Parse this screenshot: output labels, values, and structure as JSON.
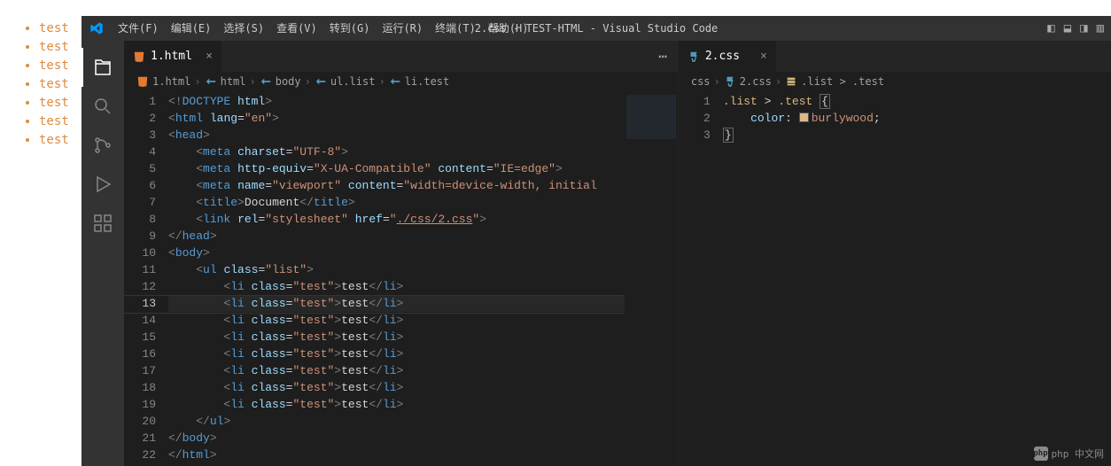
{
  "browser_list": [
    "test",
    "test",
    "test",
    "test",
    "test",
    "test",
    "test"
  ],
  "menu": [
    "文件(F)",
    "编辑(E)",
    "选择(S)",
    "查看(V)",
    "转到(G)",
    "运行(R)",
    "终端(T)",
    "帮助(H)"
  ],
  "window_title": "2.css - TEST-HTML - Visual Studio Code",
  "tabs_left": [
    {
      "label": "1.html",
      "icon": "html-icon",
      "active": true
    }
  ],
  "tabs_right": [
    {
      "label": "2.css",
      "icon": "css-icon",
      "active": true
    }
  ],
  "breadcrumb_left": [
    "1.html",
    "html",
    "body",
    "ul.list",
    "li.test"
  ],
  "breadcrumb_right": [
    "css",
    "2.css",
    ".list > .test"
  ],
  "code_left": {
    "current_line": 13,
    "lines": [
      {
        "n": 1,
        "html": "<span class='mtk-gray'>&lt;!</span><span class='mtk-blue'>DOCTYPE</span> <span class='mtk-lightblue'>html</span><span class='mtk-gray'>&gt;</span>"
      },
      {
        "n": 2,
        "html": "<span class='mtk-gray'>&lt;</span><span class='mtk-blue'>html</span> <span class='mtk-lightblue'>lang</span><span class='mtk-white'>=</span><span class='mtk-string'>\"en\"</span><span class='mtk-gray'>&gt;</span>"
      },
      {
        "n": 3,
        "html": "<span class='mtk-gray'>&lt;</span><span class='mtk-blue'>head</span><span class='mtk-gray'>&gt;</span>"
      },
      {
        "n": 4,
        "html": "    <span class='mtk-gray'>&lt;</span><span class='mtk-blue'>meta</span> <span class='mtk-lightblue'>charset</span><span class='mtk-white'>=</span><span class='mtk-string'>\"UTF-8\"</span><span class='mtk-gray'>&gt;</span>"
      },
      {
        "n": 5,
        "html": "    <span class='mtk-gray'>&lt;</span><span class='mtk-blue'>meta</span> <span class='mtk-lightblue'>http-equiv</span><span class='mtk-white'>=</span><span class='mtk-string'>\"X-UA-Compatible\"</span> <span class='mtk-lightblue'>content</span><span class='mtk-white'>=</span><span class='mtk-string'>\"IE=edge\"</span><span class='mtk-gray'>&gt;</span>"
      },
      {
        "n": 6,
        "html": "    <span class='mtk-gray'>&lt;</span><span class='mtk-blue'>meta</span> <span class='mtk-lightblue'>name</span><span class='mtk-white'>=</span><span class='mtk-string'>\"viewport\"</span> <span class='mtk-lightblue'>content</span><span class='mtk-white'>=</span><span class='mtk-string'>\"width=device-width, initial</span>"
      },
      {
        "n": 7,
        "html": "    <span class='mtk-gray'>&lt;</span><span class='mtk-blue'>title</span><span class='mtk-gray'>&gt;</span><span class='mtk-white'>Document</span><span class='mtk-gray'>&lt;/</span><span class='mtk-blue'>title</span><span class='mtk-gray'>&gt;</span>"
      },
      {
        "n": 8,
        "html": "    <span class='mtk-gray'>&lt;</span><span class='mtk-blue'>link</span> <span class='mtk-lightblue'>rel</span><span class='mtk-white'>=</span><span class='mtk-string'>\"stylesheet\"</span> <span class='mtk-lightblue'>href</span><span class='mtk-white'>=</span><span class='mtk-string'>\"</span><span class='mtk-link'>./css/2.css</span><span class='mtk-string'>\"</span><span class='mtk-gray'>&gt;</span>"
      },
      {
        "n": 9,
        "html": "<span class='mtk-gray'>&lt;/</span><span class='mtk-blue'>head</span><span class='mtk-gray'>&gt;</span>"
      },
      {
        "n": 10,
        "html": "<span class='mtk-gray'>&lt;</span><span class='mtk-blue'>body</span><span class='mtk-gray'>&gt;</span>"
      },
      {
        "n": 11,
        "html": "    <span class='mtk-gray'>&lt;</span><span class='mtk-blue'>ul</span> <span class='mtk-lightblue'>class</span><span class='mtk-white'>=</span><span class='mtk-string'>\"list\"</span><span class='mtk-gray'>&gt;</span>"
      },
      {
        "n": 12,
        "html": "        <span class='mtk-gray'>&lt;</span><span class='mtk-blue'>li</span> <span class='mtk-lightblue'>class</span><span class='mtk-white'>=</span><span class='mtk-string'>\"test\"</span><span class='mtk-gray'>&gt;</span><span class='mtk-white'>test</span><span class='mtk-gray'>&lt;/</span><span class='mtk-blue'>li</span><span class='mtk-gray'>&gt;</span>"
      },
      {
        "n": 13,
        "html": "        <span class='mtk-gray'>&lt;</span><span class='mtk-blue'>li</span> <span class='mtk-lightblue'>class</span><span class='mtk-white'>=</span><span class='mtk-string'>\"test\"</span><span class='mtk-gray'>&gt;</span><span class='mtk-white'>test</span><span class='mtk-gray'>&lt;/</span><span class='mtk-blue'>li</span><span class='mtk-gray'>&gt;</span>"
      },
      {
        "n": 14,
        "html": "        <span class='mtk-gray'>&lt;</span><span class='mtk-blue'>li</span> <span class='mtk-lightblue'>class</span><span class='mtk-white'>=</span><span class='mtk-string'>\"test\"</span><span class='mtk-gray'>&gt;</span><span class='mtk-white'>test</span><span class='mtk-gray'>&lt;/</span><span class='mtk-blue'>li</span><span class='mtk-gray'>&gt;</span>"
      },
      {
        "n": 15,
        "html": "        <span class='mtk-gray'>&lt;</span><span class='mtk-blue'>li</span> <span class='mtk-lightblue'>class</span><span class='mtk-white'>=</span><span class='mtk-string'>\"test\"</span><span class='mtk-gray'>&gt;</span><span class='mtk-white'>test</span><span class='mtk-gray'>&lt;/</span><span class='mtk-blue'>li</span><span class='mtk-gray'>&gt;</span>"
      },
      {
        "n": 16,
        "html": "        <span class='mtk-gray'>&lt;</span><span class='mtk-blue'>li</span> <span class='mtk-lightblue'>class</span><span class='mtk-white'>=</span><span class='mtk-string'>\"test\"</span><span class='mtk-gray'>&gt;</span><span class='mtk-white'>test</span><span class='mtk-gray'>&lt;/</span><span class='mtk-blue'>li</span><span class='mtk-gray'>&gt;</span>"
      },
      {
        "n": 17,
        "html": "        <span class='mtk-gray'>&lt;</span><span class='mtk-blue'>li</span> <span class='mtk-lightblue'>class</span><span class='mtk-white'>=</span><span class='mtk-string'>\"test\"</span><span class='mtk-gray'>&gt;</span><span class='mtk-white'>test</span><span class='mtk-gray'>&lt;/</span><span class='mtk-blue'>li</span><span class='mtk-gray'>&gt;</span>"
      },
      {
        "n": 18,
        "html": "        <span class='mtk-gray'>&lt;</span><span class='mtk-blue'>li</span> <span class='mtk-lightblue'>class</span><span class='mtk-white'>=</span><span class='mtk-string'>\"test\"</span><span class='mtk-gray'>&gt;</span><span class='mtk-white'>test</span><span class='mtk-gray'>&lt;/</span><span class='mtk-blue'>li</span><span class='mtk-gray'>&gt;</span>"
      },
      {
        "n": 19,
        "html": "        <span class='mtk-gray'>&lt;</span><span class='mtk-blue'>li</span> <span class='mtk-lightblue'>class</span><span class='mtk-white'>=</span><span class='mtk-string'>\"test\"</span><span class='mtk-gray'>&gt;</span><span class='mtk-white'>test</span><span class='mtk-gray'>&lt;/</span><span class='mtk-blue'>li</span><span class='mtk-gray'>&gt;</span>"
      },
      {
        "n": 20,
        "html": "    <span class='mtk-gray'>&lt;/</span><span class='mtk-blue'>ul</span><span class='mtk-gray'>&gt;</span>"
      },
      {
        "n": 21,
        "html": "<span class='mtk-gray'>&lt;/</span><span class='mtk-blue'>body</span><span class='mtk-gray'>&gt;</span>"
      },
      {
        "n": 22,
        "html": "<span class='mtk-gray'>&lt;/</span><span class='mtk-blue'>html</span><span class='mtk-gray'>&gt;</span>"
      }
    ]
  },
  "code_right": {
    "lines": [
      {
        "n": 1,
        "html": "<span class='mtk-selector'>.list</span> <span class='mtk-white'>&gt;</span> <span class='mtk-selector'>.test</span> <span class='mtk-brace-active mtk-white'>{</span>"
      },
      {
        "n": 2,
        "html": "    <span class='mtk-lightblue'>color</span><span class='mtk-white'>:</span> <span class='color-chip' style='background:#deb887'></span><span class='mtk-string'>burlywood</span><span class='mtk-white'>;</span>"
      },
      {
        "n": 3,
        "html": "<span class='mtk-brace-active mtk-white'>}</span>"
      }
    ]
  },
  "watermark": "php 中文网"
}
